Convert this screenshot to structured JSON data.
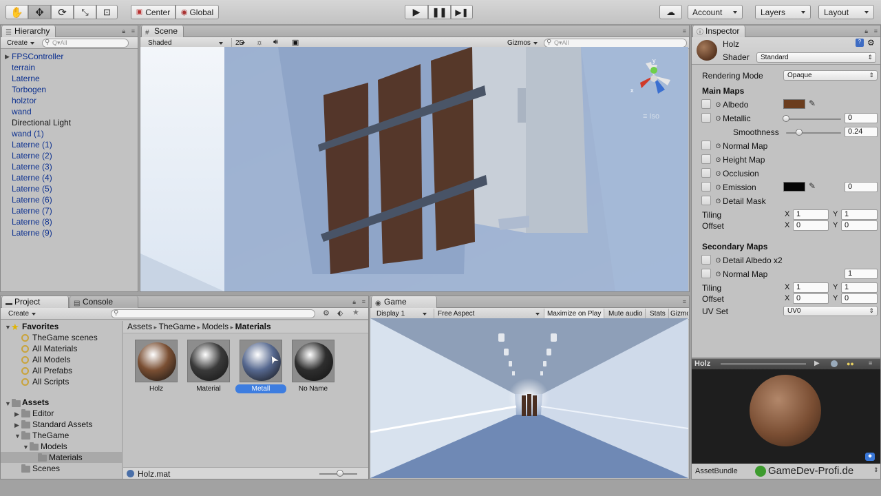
{
  "toolbar": {
    "pivot_label": "Center",
    "space_label": "Global",
    "account_label": "Account",
    "layers_label": "Layers",
    "layout_label": "Layout"
  },
  "hierarchy": {
    "tab_label": "Hierarchy",
    "create_label": "Create",
    "search_placeholder": "Q▾All",
    "items": [
      {
        "label": "FPSController",
        "prefab": true
      },
      {
        "label": "terrain",
        "prefab": true
      },
      {
        "label": "Laterne",
        "prefab": true
      },
      {
        "label": "Torbogen",
        "prefab": true
      },
      {
        "label": "holztor",
        "prefab": true
      },
      {
        "label": "wand",
        "prefab": true
      },
      {
        "label": "Directional Light",
        "prefab": false
      },
      {
        "label": "wand (1)",
        "prefab": true
      },
      {
        "label": "Laterne (1)",
        "prefab": true
      },
      {
        "label": "Laterne (2)",
        "prefab": true
      },
      {
        "label": "Laterne (3)",
        "prefab": true
      },
      {
        "label": "Laterne (4)",
        "prefab": true
      },
      {
        "label": "Laterne (5)",
        "prefab": true
      },
      {
        "label": "Laterne (6)",
        "prefab": true
      },
      {
        "label": "Laterne (7)",
        "prefab": true
      },
      {
        "label": "Laterne (8)",
        "prefab": true
      },
      {
        "label": "Laterne (9)",
        "prefab": true
      }
    ]
  },
  "scene": {
    "tab_label": "Scene",
    "shading_label": "Shaded",
    "mode_2d_label": "2D",
    "gizmos_label": "Gizmos",
    "search_placeholder": "Q▾All",
    "projection_label": "≡ Iso",
    "axis_y": "y",
    "axis_x": "x"
  },
  "inspector": {
    "tab_label": "Inspector",
    "material_name": "Holz",
    "shader_label": "Shader",
    "shader_value": "Standard",
    "rendering_mode_label": "Rendering Mode",
    "rendering_mode_value": "Opaque",
    "main_maps_label": "Main Maps",
    "albedo_label": "Albedo",
    "albedo_color": "#6b3d1e",
    "metallic_label": "Metallic",
    "metallic_value": "0",
    "metallic_level": 0,
    "smoothness_label": "Smoothness",
    "smoothness_value": "0.24",
    "smoothness_level": 0.24,
    "normal_map_label": "Normal Map",
    "height_map_label": "Height Map",
    "occlusion_label": "Occlusion",
    "emission_label": "Emission",
    "emission_color": "#050505",
    "emission_value": "0",
    "detail_mask_label": "Detail Mask",
    "tiling_label": "Tiling",
    "offset_label": "Offset",
    "x_label": "X",
    "y_label": "Y",
    "tiling_x": "1",
    "tiling_y": "1",
    "offset_x": "0",
    "offset_y": "0",
    "secondary_maps_label": "Secondary Maps",
    "detail_albedo_label": "Detail Albedo x2",
    "normal_map2_label": "Normal Map",
    "normal_map2_value": "1",
    "tiling2_x": "1",
    "tiling2_y": "1",
    "offset2_x": "0",
    "offset2_y": "0",
    "uv_set_label": "UV Set",
    "uv_set_value": "UV0"
  },
  "preview": {
    "title": "Holz",
    "assetbundle_label": "AssetBundle",
    "watermark": "GameDev-Profi.de"
  },
  "project": {
    "tab_label": "Project",
    "console_tab_label": "Console",
    "create_label": "Create",
    "favorites_label": "Favorites",
    "favorites": [
      "TheGame scenes",
      "All Materials",
      "All Models",
      "All Prefabs",
      "All Scripts"
    ],
    "assets_label": "Assets",
    "folders": [
      {
        "label": "Editor",
        "depth": 1
      },
      {
        "label": "Standard Assets",
        "depth": 1
      },
      {
        "label": "TheGame",
        "depth": 1
      },
      {
        "label": "Models",
        "depth": 2
      },
      {
        "label": "Materials",
        "depth": 3
      },
      {
        "label": "Scenes",
        "depth": 1
      }
    ],
    "breadcrumb": [
      "Assets",
      "TheGame",
      "Models",
      "Materials"
    ],
    "materials": [
      {
        "label": "Holz",
        "color": "#7a4f33"
      },
      {
        "label": "Material",
        "color": "#3a3a3a"
      },
      {
        "label": "Metall",
        "color": "#56688f"
      },
      {
        "label": "No Name",
        "color": "#2e2e2e"
      }
    ],
    "selected_material": "Metall",
    "status_file": "Holz.mat"
  },
  "game": {
    "tab_label": "Game",
    "display_label": "Display 1",
    "aspect_label": "Free Aspect",
    "maximize_label": "Maximize on Play",
    "mute_label": "Mute audio",
    "stats_label": "Stats",
    "gizmos_label": "Gizmo"
  }
}
